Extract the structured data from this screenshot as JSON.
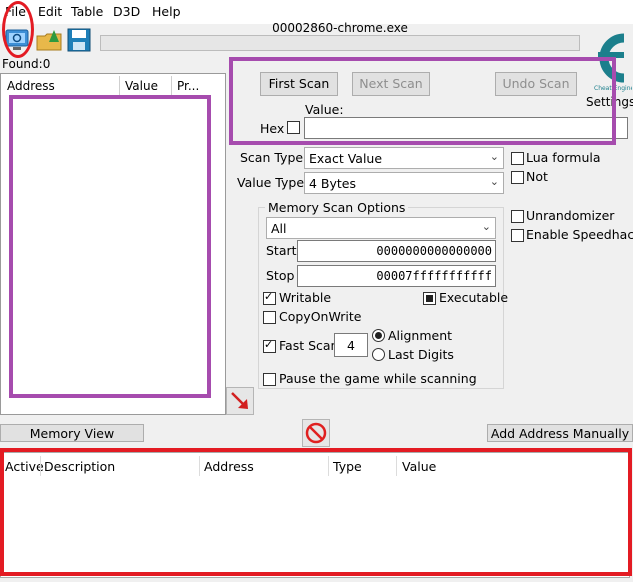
{
  "menu": {
    "items": [
      "File",
      "Edit",
      "Table",
      "D3D",
      "Help"
    ]
  },
  "toolbar": {
    "process_title": "00002860-chrome.exe",
    "settings_label": "Settings"
  },
  "found": {
    "label": "Found:0"
  },
  "results": {
    "columns": [
      "Address",
      "Value",
      "Pr..."
    ]
  },
  "scan": {
    "first_scan": "First Scan",
    "next_scan": "Next Scan",
    "undo_scan": "Undo Scan",
    "value_label": "Value:",
    "hex_label": "Hex",
    "scan_type_label": "Scan Type",
    "scan_type_value": "Exact Value",
    "value_type_label": "Value Type",
    "value_type_value": "4 Bytes"
  },
  "options": {
    "lua_formula": "Lua formula",
    "not": "Not",
    "unrandomizer": "Unrandomizer",
    "enable_speedhack": "Enable Speedhack"
  },
  "memory_scan": {
    "title": "Memory Scan Options",
    "region": "All",
    "start_label": "Start",
    "start_value": "0000000000000000",
    "stop_label": "Stop",
    "stop_value": "00007fffffffffff",
    "writable": "Writable",
    "executable": "Executable",
    "copy_on_write": "CopyOnWrite",
    "fast_scan": "Fast Scan",
    "fast_scan_value": "4",
    "alignment": "Alignment",
    "last_digits": "Last Digits",
    "pause_game": "Pause the game while scanning"
  },
  "bottom": {
    "memory_view": "Memory View",
    "add_address": "Add Address Manually"
  },
  "address_table": {
    "columns": [
      "Active",
      "Description",
      "Address",
      "Type",
      "Value"
    ]
  },
  "colors": {
    "annotation_purple": "#a64cae",
    "annotation_red": "#e31b23"
  }
}
